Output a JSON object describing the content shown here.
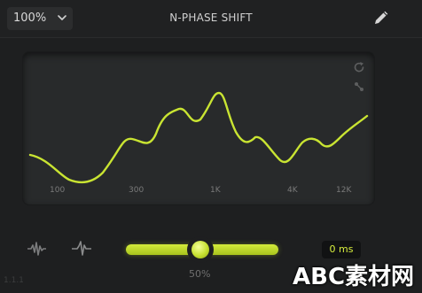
{
  "header": {
    "zoom_value": "100%",
    "title": "N-PHASE SHIFT"
  },
  "graph": {
    "freq_labels": [
      "100",
      "300",
      "1K",
      "4K",
      "12K"
    ],
    "curve_color": "#c9e432",
    "accent_color": "#d4ec3b"
  },
  "icons": {
    "zoom_chevron": "chevron-down-icon",
    "edit": "pencil-icon",
    "reset": "refresh-icon",
    "nodes": "nodes-icon",
    "wave_left": "waveform-icon",
    "wave_right": "waveform-icon"
  },
  "controls": {
    "slider_label": "50%",
    "slider_fraction": 0.5,
    "delay_value": "0 ms"
  },
  "footer": {
    "corner_text": "1.1.1",
    "watermark": "ABC素材网"
  }
}
